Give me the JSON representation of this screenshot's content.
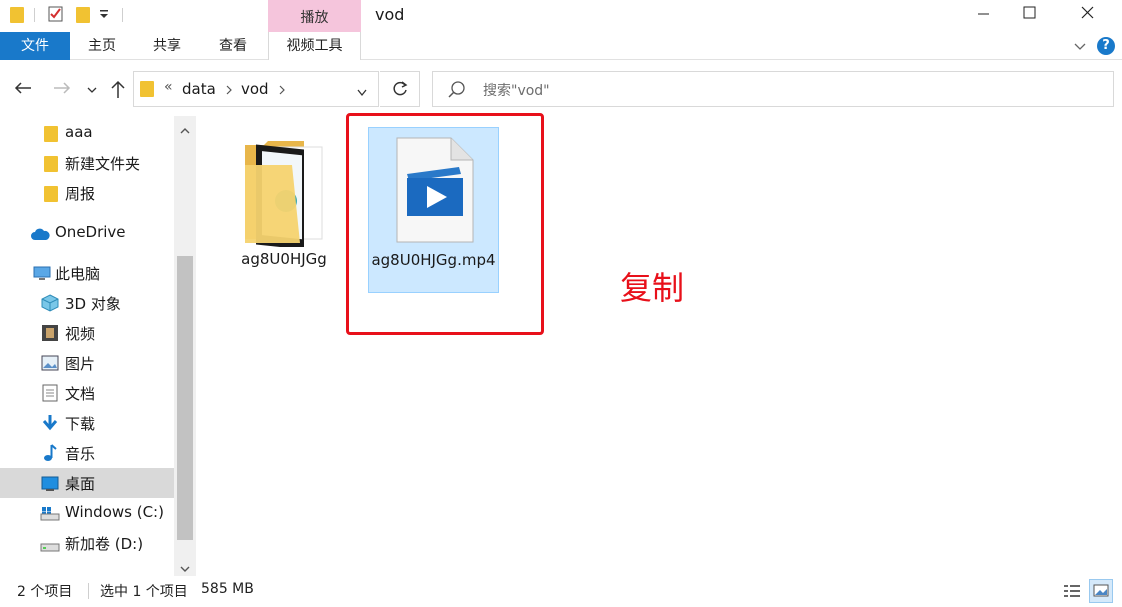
{
  "titlebar": {
    "window_title": "vod",
    "context_tab_group": "播放",
    "icons": [
      "folder-icon",
      "properties-icon",
      "new-folder-icon",
      "customize-dropdown-icon"
    ],
    "minimize_glyph": "—",
    "maximize_glyph": "☐",
    "close_glyph": "✕"
  },
  "ribbon": {
    "tabs": [
      {
        "label": "文件"
      },
      {
        "label": "主页"
      },
      {
        "label": "共享"
      },
      {
        "label": "查看"
      },
      {
        "label": "视频工具"
      }
    ],
    "help_glyph": "?"
  },
  "address": {
    "overflow": "«",
    "crumbs": [
      "data",
      "vod"
    ],
    "search_placeholder": "搜索\"vod\""
  },
  "nav": {
    "items": [
      {
        "label": "aaa",
        "icon": "folder-icon"
      },
      {
        "label": "新建文件夹",
        "icon": "folder-icon"
      },
      {
        "label": "周报",
        "icon": "folder-icon"
      },
      {
        "label": "OneDrive",
        "icon": "cloud-icon"
      },
      {
        "label": "此电脑",
        "icon": "computer-icon"
      },
      {
        "label": "3D 对象",
        "icon": "cube-icon"
      },
      {
        "label": "视频",
        "icon": "film-icon"
      },
      {
        "label": "图片",
        "icon": "picture-icon"
      },
      {
        "label": "文档",
        "icon": "document-icon"
      },
      {
        "label": "下载",
        "icon": "download-arrow-icon"
      },
      {
        "label": "音乐",
        "icon": "music-note-icon"
      },
      {
        "label": "桌面",
        "icon": "desktop-icon"
      },
      {
        "label": "Windows (C:)",
        "icon": "windows-drive-icon"
      },
      {
        "label": "新加卷 (D:)",
        "icon": "drive-icon"
      }
    ],
    "selected": "桌面"
  },
  "files": [
    {
      "name": "ag8U0HJGg",
      "type": "folder"
    },
    {
      "name": "ag8U0HJGg.mp4",
      "type": "video",
      "selected": true
    }
  ],
  "annotation": {
    "text": "复制",
    "color": "#e8101a"
  },
  "status": {
    "count": "2 个项目",
    "selection": "选中 1 个项目",
    "size": "585 MB"
  },
  "colors": {
    "accent": "#1979ca",
    "selection": "#cce8ff",
    "context_tab": "#f5c5dc"
  }
}
